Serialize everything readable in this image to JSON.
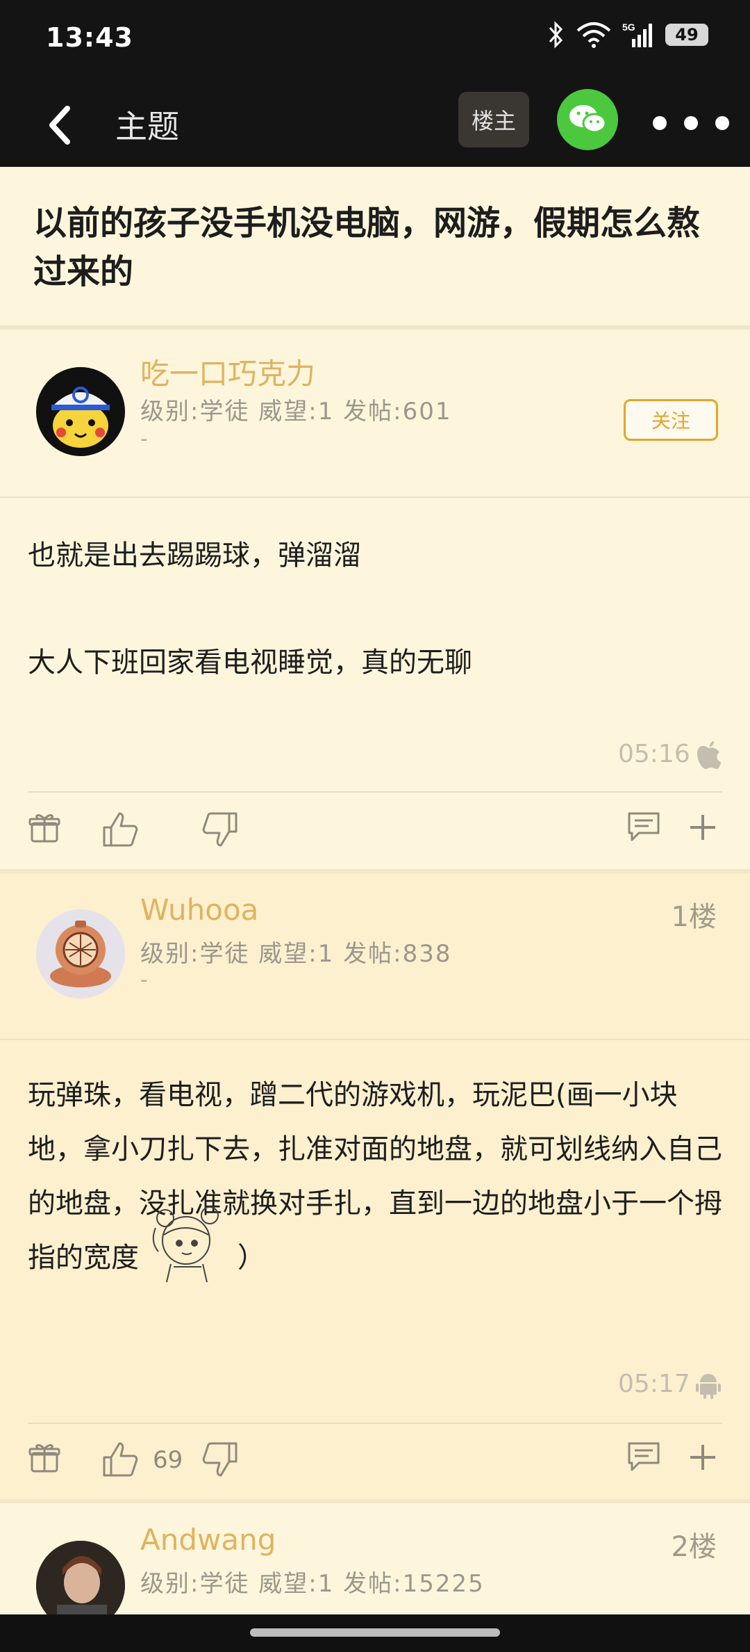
{
  "status_bar": {
    "time": "13:43",
    "battery": "49",
    "network": "5G"
  },
  "top_bar": {
    "title": "主题",
    "owner_button": "楼主"
  },
  "thread": {
    "title": "以前的孩子没手机没电脑，网游，假期怎么熬过来的"
  },
  "posts": [
    {
      "username": "吃一口巧克力",
      "meta": "级别:学徒 威望:1 发帖:601",
      "dash": "-",
      "follow_label": "关注",
      "lines": [
        "也就是出去踢踢球，弹溜溜",
        "大人下班回家看电视睡觉，真的无聊"
      ],
      "time": "05:16",
      "device_icon": "apple-icon"
    },
    {
      "username": "Wuhooa",
      "meta": "级别:学徒 威望:1 发帖:838",
      "dash": "-",
      "floor": "1楼",
      "text": "玩弹珠，看电视，蹭二代的游戏机，玩泥巴(画一小块地，拿小刀扎下去，扎准对面的地盘，就可划线纳入自己的地盘，没扎准就换对手扎，直到一边的地盘小于一个拇指的宽度",
      "text_end": "）",
      "time": "05:17",
      "device_icon": "android-icon",
      "likes": "69"
    },
    {
      "username": "Andwang",
      "meta": "级别:学徒 威望:1 发帖:15225",
      "floor": "2楼"
    }
  ],
  "colors": {
    "accent": "#e0b35e",
    "background": "#fdf6dc",
    "wechat": "#4cc83f"
  }
}
